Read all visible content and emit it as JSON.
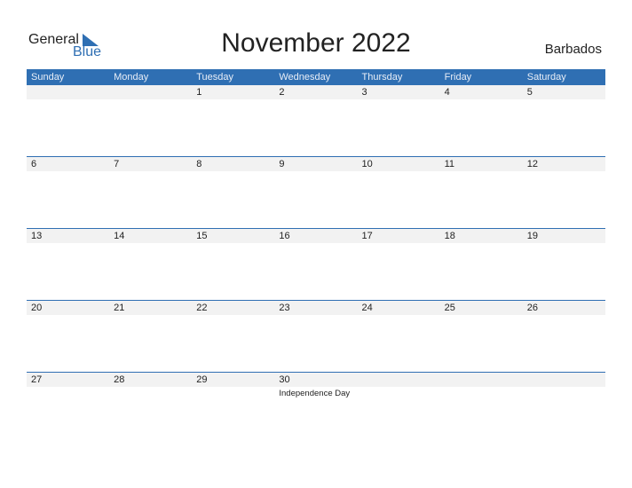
{
  "logo": {
    "general": "General",
    "blue": "Blue"
  },
  "title": "November 2022",
  "country": "Barbados",
  "colors": {
    "accent": "#2f6fb3",
    "strip": "#f2f2f2"
  },
  "weekdays": [
    "Sunday",
    "Monday",
    "Tuesday",
    "Wednesday",
    "Thursday",
    "Friday",
    "Saturday"
  ],
  "weeks": [
    {
      "days": [
        "",
        "",
        "1",
        "2",
        "3",
        "4",
        "5"
      ],
      "events": [
        "",
        "",
        "",
        "",
        "",
        "",
        ""
      ]
    },
    {
      "days": [
        "6",
        "7",
        "8",
        "9",
        "10",
        "11",
        "12"
      ],
      "events": [
        "",
        "",
        "",
        "",
        "",
        "",
        ""
      ]
    },
    {
      "days": [
        "13",
        "14",
        "15",
        "16",
        "17",
        "18",
        "19"
      ],
      "events": [
        "",
        "",
        "",
        "",
        "",
        "",
        ""
      ]
    },
    {
      "days": [
        "20",
        "21",
        "22",
        "23",
        "24",
        "25",
        "26"
      ],
      "events": [
        "",
        "",
        "",
        "",
        "",
        "",
        ""
      ]
    },
    {
      "days": [
        "27",
        "28",
        "29",
        "30",
        "",
        "",
        ""
      ],
      "events": [
        "",
        "",
        "",
        "Independence Day",
        "",
        "",
        ""
      ]
    }
  ]
}
